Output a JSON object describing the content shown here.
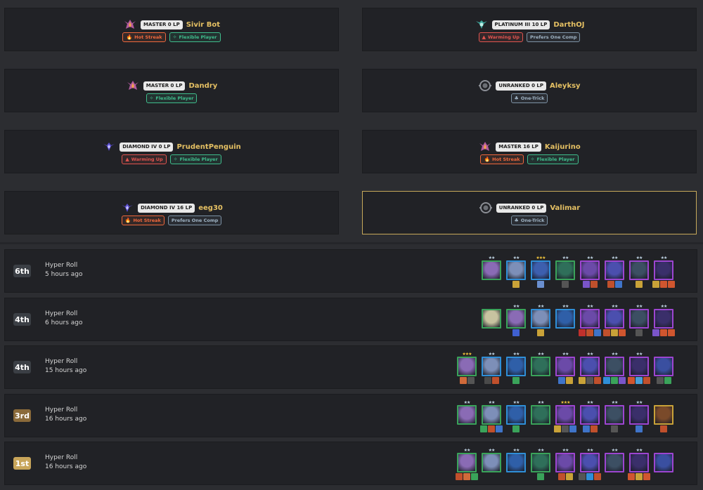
{
  "colors": {
    "accent_gold": "#e5c063",
    "panel": "#212226",
    "background": "#2c2d31"
  },
  "players": [
    {
      "rank": "MASTER 0 LP",
      "name": "Sivir Bot",
      "emblem": "master-emblem-icon",
      "tags": [
        {
          "label": "Hot Streak",
          "kind": "hot"
        },
        {
          "label": "Flexible Player",
          "kind": "flex"
        }
      ]
    },
    {
      "rank": "PLATINUM III 10 LP",
      "name": "DarthOJ",
      "emblem": "platinum-emblem-icon",
      "tags": [
        {
          "label": "Warming Up",
          "kind": "warm"
        },
        {
          "label": "Prefers One Comp",
          "kind": "comp"
        }
      ]
    },
    {
      "rank": "MASTER 0 LP",
      "name": "Dandry",
      "emblem": "master-emblem-icon",
      "tags": [
        {
          "label": "Flexible Player",
          "kind": "flex"
        }
      ]
    },
    {
      "rank": "UNRANKED 0 LP",
      "name": "Aleyksy",
      "emblem": "unranked-emblem-icon",
      "tags": [
        {
          "label": "One-Trick",
          "kind": "trick"
        }
      ]
    },
    {
      "rank": "DIAMOND IV 0 LP",
      "name": "PrudentPenguin",
      "emblem": "diamond-emblem-icon",
      "tags": [
        {
          "label": "Warming Up",
          "kind": "warm"
        },
        {
          "label": "Flexible Player",
          "kind": "flex"
        }
      ]
    },
    {
      "rank": "MASTER 16 LP",
      "name": "Kaijurino",
      "emblem": "master-emblem-icon",
      "tags": [
        {
          "label": "Hot Streak",
          "kind": "hot"
        },
        {
          "label": "Flexible Player",
          "kind": "flex"
        }
      ]
    },
    {
      "rank": "DIAMOND IV 16 LP",
      "name": "eeg30",
      "emblem": "diamond-emblem-icon",
      "tags": [
        {
          "label": "Hot Streak",
          "kind": "hot"
        },
        {
          "label": "Prefers One Comp",
          "kind": "comp"
        }
      ]
    },
    {
      "rank": "UNRANKED 0 LP",
      "name": "Valimar",
      "emblem": "unranked-emblem-icon",
      "tags": [
        {
          "label": "One-Trick",
          "kind": "trick"
        }
      ],
      "highlighted": true
    }
  ],
  "matches": [
    {
      "place": "6th",
      "mode": "Hyper Roll",
      "time": "5 hours ago",
      "place_color": "#3b3f45",
      "units": [
        {
          "stars": 2,
          "border": "#3aa35a",
          "face": "#8a6bb5",
          "items": []
        },
        {
          "stars": 2,
          "border": "#2f8fd8",
          "face": "#7d8fb8",
          "items": [
            "#c9a238"
          ]
        },
        {
          "stars": 3,
          "border": "#2f8fd8",
          "face": "#3d5fae",
          "items": [
            "#6a8fd0"
          ]
        },
        {
          "stars": 2,
          "border": "#3aa35a",
          "face": "#2f6f5a",
          "items": [
            "#555555"
          ]
        },
        {
          "stars": 2,
          "border": "#9d45d1",
          "face": "#6b4aa8",
          "items": [
            "#7a55c9",
            "#c0502c"
          ]
        },
        {
          "stars": 2,
          "border": "#9d45d1",
          "face": "#4b4fae",
          "items": [
            "#c0502c",
            "#3f74c9"
          ]
        },
        {
          "stars": 2,
          "border": "#9d45d1",
          "face": "#3c4f63",
          "items": [
            "#c9a238"
          ]
        },
        {
          "stars": 2,
          "border": "#9d45d1",
          "face": "#3a2f6a",
          "items": [
            "#c9a238",
            "#d0562f",
            "#d0562f"
          ]
        }
      ]
    },
    {
      "place": "4th",
      "mode": "Hyper Roll",
      "time": "6 hours ago",
      "place_color": "#3b3f45",
      "units": [
        {
          "stars": 0,
          "border": "#3aa35a",
          "face": "#c8c3a0",
          "items": []
        },
        {
          "stars": 2,
          "border": "#3aa35a",
          "face": "#8a6bb5",
          "items": [
            "#3f60d0"
          ]
        },
        {
          "stars": 2,
          "border": "#2f8fd8",
          "face": "#7d8fb8",
          "items": [
            "#c9a238"
          ]
        },
        {
          "stars": 2,
          "border": "#2f8fd8",
          "face": "#2f5fa8",
          "items": []
        },
        {
          "stars": 2,
          "border": "#9d45d1",
          "face": "#6b4aa8",
          "items": [
            "#c0302c",
            "#c0502c",
            "#3f74c9"
          ]
        },
        {
          "stars": 2,
          "border": "#9d45d1",
          "face": "#4b4fae",
          "items": [
            "#c0502c",
            "#c9a238",
            "#d0562f"
          ]
        },
        {
          "stars": 2,
          "border": "#9d45d1",
          "face": "#3c4f63",
          "items": [
            "#555555"
          ]
        },
        {
          "stars": 2,
          "border": "#9d45d1",
          "face": "#3a2f6a",
          "items": [
            "#7a55c9",
            "#d0562f",
            "#d0562f"
          ]
        }
      ]
    },
    {
      "place": "4th",
      "mode": "Hyper Roll",
      "time": "15 hours ago",
      "place_color": "#3b3f45",
      "units": [
        {
          "stars": 3,
          "border": "#3aa35a",
          "face": "#8a6bb5",
          "items": [
            "#d06a3a",
            "#555555"
          ]
        },
        {
          "stars": 2,
          "border": "#2f8fd8",
          "face": "#7d8fb8",
          "items": [
            "#4a4a4a",
            "#c0502c"
          ]
        },
        {
          "stars": 2,
          "border": "#2f8fd8",
          "face": "#2f5fa8",
          "items": [
            "#3aa35a"
          ]
        },
        {
          "stars": 2,
          "border": "#3aa35a",
          "face": "#2f6f5a",
          "items": []
        },
        {
          "stars": 2,
          "border": "#9d45d1",
          "face": "#6b4aa8",
          "items": [
            "#3f74c9",
            "#c9a238"
          ]
        },
        {
          "stars": 2,
          "border": "#9d45d1",
          "face": "#4b4fae",
          "items": [
            "#c9a238",
            "#555555",
            "#c0502c"
          ]
        },
        {
          "stars": 2,
          "border": "#9d45d1",
          "face": "#3c4f63",
          "items": [
            "#2f8fd8",
            "#3aa35a",
            "#7a55c9"
          ]
        },
        {
          "stars": 2,
          "border": "#9d45d1",
          "face": "#3a2f6a",
          "items": [
            "#d0562f",
            "#48a0d8",
            "#c0502c"
          ]
        },
        {
          "stars": 0,
          "border": "#9d45d1",
          "face": "#3a4fa0",
          "items": [
            "#555555",
            "#3aa35a"
          ]
        }
      ]
    },
    {
      "place": "3rd",
      "mode": "Hyper Roll",
      "time": "16 hours ago",
      "place_color": "#8a6a3a",
      "units": [
        {
          "stars": 2,
          "border": "#3aa35a",
          "face": "#8a6bb5",
          "items": []
        },
        {
          "stars": 2,
          "border": "#3aa35a",
          "face": "#7d8fb8",
          "items": [
            "#3aa35a",
            "#c0502c",
            "#3f74c9"
          ]
        },
        {
          "stars": 2,
          "border": "#2f8fd8",
          "face": "#2f5fa8",
          "items": [
            "#3aa35a"
          ]
        },
        {
          "stars": 2,
          "border": "#3aa35a",
          "face": "#2f6f5a",
          "items": []
        },
        {
          "stars": 3,
          "border": "#9d45d1",
          "face": "#6b4aa8",
          "items": [
            "#c9a238",
            "#555555",
            "#3f74c9"
          ]
        },
        {
          "stars": 2,
          "border": "#9d45d1",
          "face": "#4b4fae",
          "items": [
            "#3f74c9",
            "#c0502c"
          ]
        },
        {
          "stars": 2,
          "border": "#9d45d1",
          "face": "#3c4f63",
          "items": [
            "#555555"
          ]
        },
        {
          "stars": 2,
          "border": "#9d45d1",
          "face": "#3a2f6a",
          "items": [
            "#3f74c9"
          ]
        },
        {
          "stars": 0,
          "border": "#c9a238",
          "face": "#7a4a2a",
          "items": [
            "#c0502c"
          ]
        }
      ]
    },
    {
      "place": "1st",
      "mode": "Hyper Roll",
      "time": "16 hours ago",
      "place_color": "#c8a55a",
      "units": [
        {
          "stars": 2,
          "border": "#3aa35a",
          "face": "#8a6bb5",
          "items": [
            "#c0502c",
            "#d06a3a",
            "#3aa35a"
          ]
        },
        {
          "stars": 2,
          "border": "#3aa35a",
          "face": "#7d8fb8",
          "items": []
        },
        {
          "stars": 2,
          "border": "#2f8fd8",
          "face": "#2f5fa8",
          "items": []
        },
        {
          "stars": 2,
          "border": "#3aa35a",
          "face": "#2f6f5a",
          "items": [
            "#3aa35a"
          ]
        },
        {
          "stars": 2,
          "border": "#9d45d1",
          "face": "#6b4aa8",
          "items": [
            "#c0502c",
            "#c9a238"
          ]
        },
        {
          "stars": 2,
          "border": "#9d45d1",
          "face": "#4b4fae",
          "items": [
            "#555555",
            "#2f8fd8",
            "#c0502c"
          ]
        },
        {
          "stars": 2,
          "border": "#9d45d1",
          "face": "#3c4f63",
          "items": []
        },
        {
          "stars": 2,
          "border": "#9d45d1",
          "face": "#3a2f6a",
          "items": [
            "#d0562f",
            "#c9a238",
            "#d0562f"
          ]
        },
        {
          "stars": 0,
          "border": "#9d45d1",
          "face": "#3a4fa0",
          "items": []
        }
      ]
    }
  ]
}
